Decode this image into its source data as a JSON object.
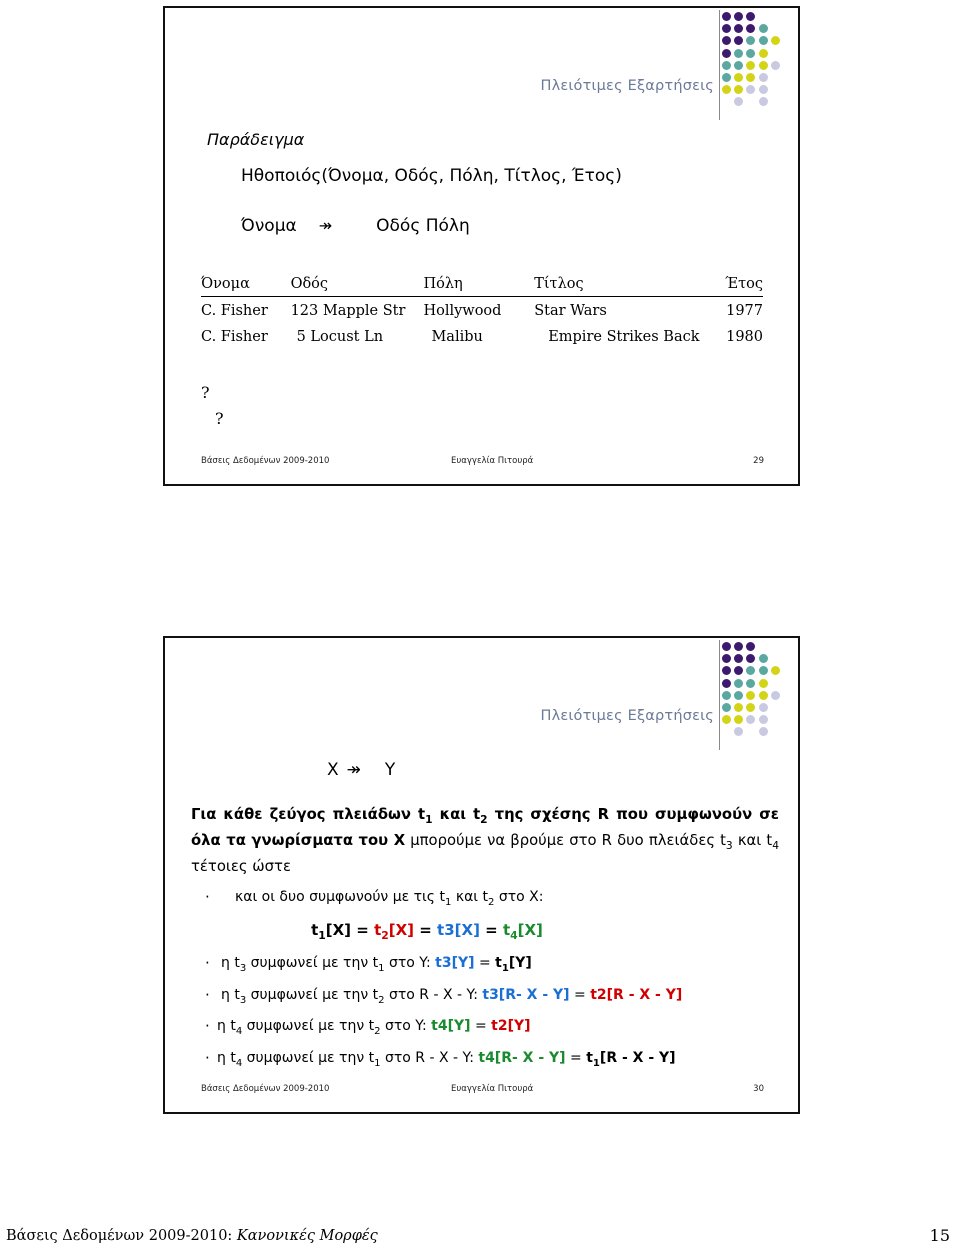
{
  "document": {
    "footer_text_prefix": "Βάσεις Δεδομένων 2009-2010: ",
    "footer_text_italic": "Κανονικές Μορφές",
    "page_number": "15"
  },
  "logo": {
    "colors": {
      "purple": "#3d1a6e",
      "teal": "#5aa8a0",
      "yellow": "#d4d417",
      "lavender": "#c9c9e2"
    },
    "grid": [
      [
        "purple",
        "purple",
        "purple",
        "none",
        "none"
      ],
      [
        "purple",
        "purple",
        "purple",
        "teal",
        "none"
      ],
      [
        "purple",
        "purple",
        "teal",
        "teal",
        "yellow"
      ],
      [
        "purple",
        "teal",
        "teal",
        "yellow",
        "none"
      ],
      [
        "teal",
        "teal",
        "yellow",
        "yellow",
        "lavender"
      ],
      [
        "teal",
        "yellow",
        "yellow",
        "lavender",
        "none"
      ],
      [
        "yellow",
        "yellow",
        "lavender",
        "lavender",
        "none"
      ],
      [
        "none",
        "lavender",
        "none",
        "lavender",
        "none"
      ]
    ]
  },
  "slide1": {
    "title": "Πλειότιμες Εξαρτήσεις",
    "example_label": "Παράδειγμα",
    "relation": "Ηθοποιός(Όνομα, Οδός, Πόλη, Τίτλος, Έτος)",
    "dependency": {
      "lhs": "Όνομα",
      "arrow": "↠",
      "rhs": "Οδός  Πόλη"
    },
    "table": {
      "headers": [
        "Όνομα",
        "Οδός",
        "Πόλη",
        "Τίτλος",
        "Έτος"
      ],
      "rows": [
        [
          "C. Fisher",
          "123 Mapple Str",
          "Hollywood",
          "Star Wars",
          "1977"
        ],
        [
          "C. Fisher",
          "5 Locust Ln",
          "Malibu",
          "Empire Strikes Back",
          "1980"
        ]
      ]
    },
    "question_marks": [
      "?",
      "?"
    ],
    "footer": {
      "left": "Βάσεις Δεδομένων 2009-2010",
      "center": "Ευαγγελία Πιτουρά",
      "right": "29"
    }
  },
  "slide2": {
    "title": "Πλειότιμες Εξαρτήσεις",
    "dependency": {
      "lhs": "X",
      "arrow": "↠",
      "rhs": "Y"
    },
    "lead": {
      "bold1": "Για κάθε ζεύγος πλειάδων t",
      "bold1_sub": "1",
      "bold2": " και t",
      "bold2_sub": "2",
      "bold3": " της σχέσης R που συμφωνούν σε όλα τα γνωρίσματα του X",
      "normal1": " μπορούμε να βρούμε στο R δυο πλειάδες t",
      "normal1_sub": "3",
      "normal2": " και t",
      "normal2_sub": "4",
      "normal3": " τέτοιες ώστε"
    },
    "bullets": [
      {
        "prefix": "και οι δυο συμφωνούν με τις t",
        "sub1": "1",
        "mid": " και t",
        "sub2": "2",
        "suffix": " στο X:"
      },
      {
        "prefix": "η t",
        "sub1": "3",
        "mid": " συμφωνεί με την t",
        "sub2": "1",
        "suffix": " στο Y: ",
        "expr_left": "t3[Y]",
        "expr_left_color": "blue",
        "eq": " = ",
        "expr_right": "t",
        "expr_right_sub": "1",
        "expr_right_rest": "[Y]",
        "expr_right_color": "black"
      },
      {
        "prefix": "η t",
        "sub1": "3",
        "mid": " συμφωνεί με την t",
        "sub2": "2",
        "suffix": " στο R - X - Y: ",
        "expr_left": "t3[R- X - Y]",
        "expr_left_color": "blue",
        "eq": " = ",
        "expr_right": "t2[R - X - Y]",
        "expr_right_color": "red"
      },
      {
        "prefix": "η t",
        "sub1": "4",
        "mid": " συμφωνεί με την t",
        "sub2": "2",
        "suffix": " στο Y: ",
        "expr_left": "t4[Y]",
        "expr_left_color": "green",
        "eq": " = ",
        "expr_right": "t2[Y]",
        "expr_right_color": "red"
      },
      {
        "prefix": "η t",
        "sub1": "4",
        "mid": " συμφωνεί με την t",
        "sub2": "1",
        "suffix": " στο R - X - Y: ",
        "expr_left": "t4[R- X - Y]",
        "expr_left_color": "green",
        "eq": " = ",
        "expr_right": "t",
        "expr_right_sub": "1",
        "expr_right_rest": "[R - X - Y]",
        "expr_right_color": "black"
      }
    ],
    "equation_line": {
      "term1": "t",
      "term1_sub": "1",
      "term1_rest": "[X]",
      "eq1": " = ",
      "term2": "t",
      "term2_sub": "2",
      "term2_rest": "[X]",
      "eq2": " = ",
      "term3": "t3[X]",
      "eq3": " = ",
      "term4": "t",
      "term4_sub": "4",
      "term4_rest": "[X]"
    },
    "footer": {
      "left": "Βάσεις Δεδομένων 2009-2010",
      "center": "Ευαγγελία Πιτουρά",
      "right": "30"
    }
  }
}
